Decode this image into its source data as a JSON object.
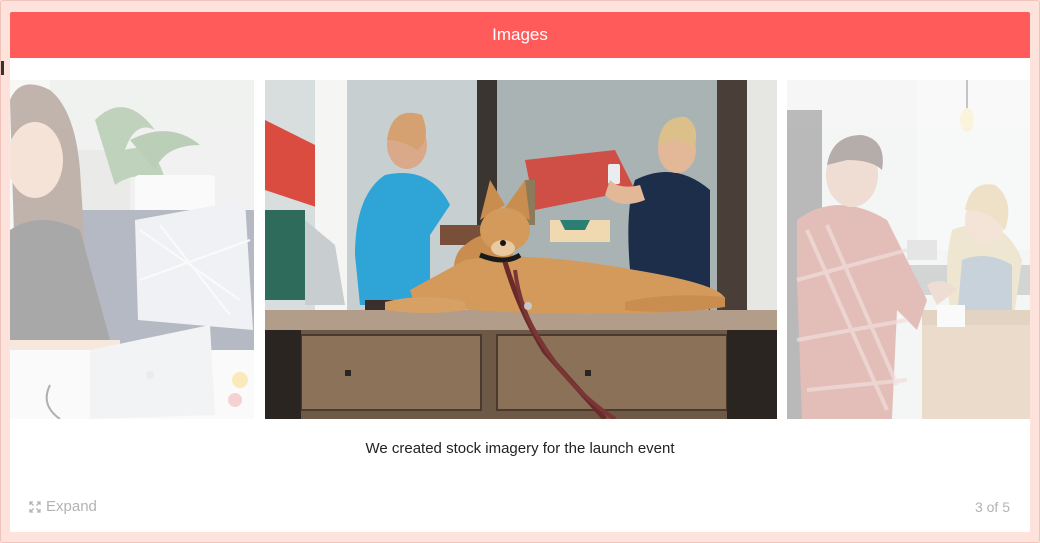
{
  "header": {
    "title": "Images"
  },
  "carousel": {
    "caption": "We created stock imagery for the launch event",
    "expand_label": "Expand",
    "expand_icon": "expand-icon",
    "counter": "3 of 5",
    "current_index": 3,
    "total": 5
  },
  "colors": {
    "header_bg": "#ff5b5b",
    "page_bg": "#fde3dc",
    "muted_text": "#b3b3b3"
  }
}
